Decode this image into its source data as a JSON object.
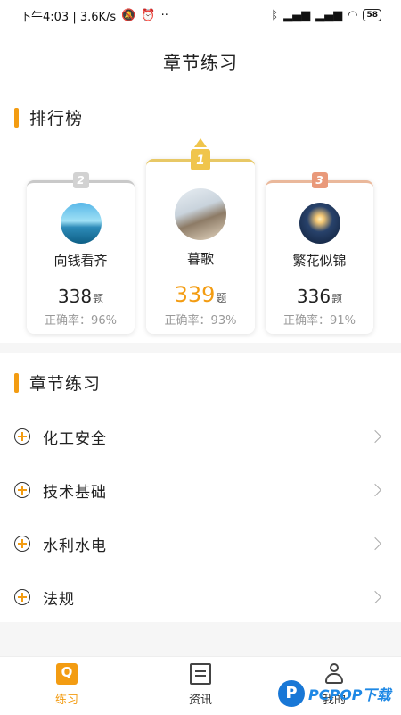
{
  "status_bar": {
    "time_speed": "下午4:03 | 3.6K/s",
    "battery": "58"
  },
  "header": {
    "title": "章节练习"
  },
  "ranking": {
    "title": "排行榜",
    "question_unit": "题",
    "entries": [
      {
        "rank": "2",
        "name": "向钱看齐",
        "score": "338",
        "accuracy": "正确率：96%"
      },
      {
        "rank": "1",
        "name": "暮歌",
        "score": "339",
        "accuracy": "正确率：93%"
      },
      {
        "rank": "3",
        "name": "繁花似锦",
        "score": "336",
        "accuracy": "正确率：91%"
      }
    ]
  },
  "chapters": {
    "title": "章节练习",
    "items": [
      {
        "label": "化工安全"
      },
      {
        "label": "技术基础"
      },
      {
        "label": "水利水电"
      },
      {
        "label": "法规"
      }
    ]
  },
  "tab_bar": {
    "tabs": [
      {
        "label": "练习",
        "icon": "practice-icon",
        "active": true
      },
      {
        "label": "资讯",
        "icon": "news-icon",
        "active": false
      },
      {
        "label": "我的",
        "icon": "profile-icon",
        "active": false
      }
    ]
  },
  "watermark": {
    "text": "PCPOP下载"
  },
  "colors": {
    "accent": "#f39c12",
    "gold": "#f0c54c",
    "silver": "#d2d2d2",
    "bronze": "#e9997a"
  }
}
